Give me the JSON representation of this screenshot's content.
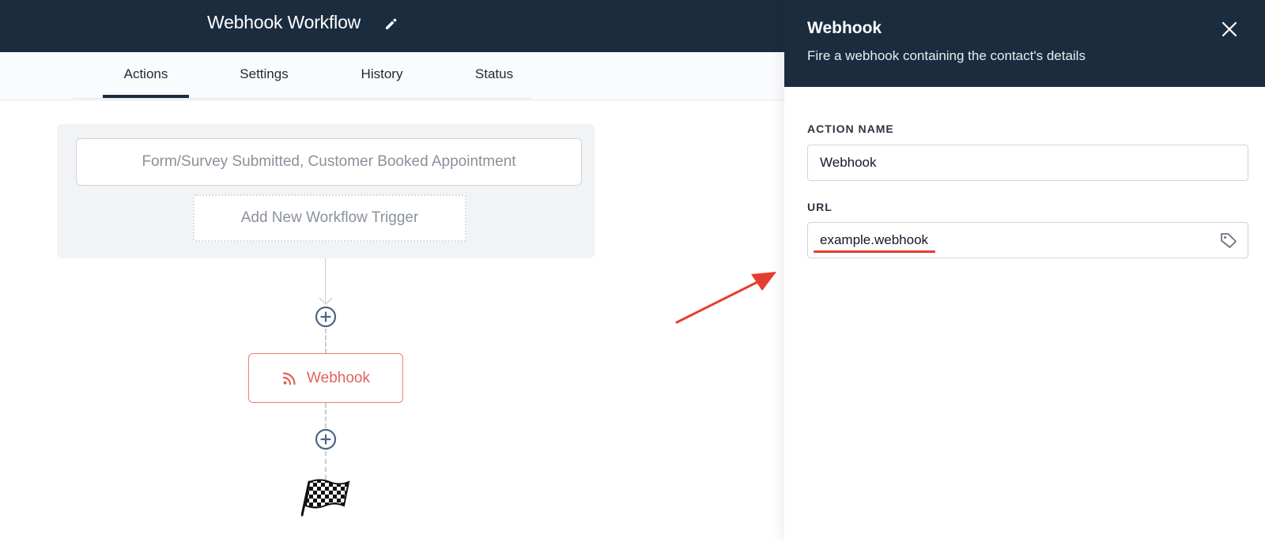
{
  "header": {
    "workflow_title": "Webhook Workflow",
    "edit_icon": "pencil-icon",
    "bg_color": "#1b2c3e"
  },
  "tabs": [
    {
      "label": "Actions",
      "active": true
    },
    {
      "label": "Settings",
      "active": false
    },
    {
      "label": "History",
      "active": false
    },
    {
      "label": "Status",
      "active": false
    }
  ],
  "triggers": {
    "trigger_label": "Form/Survey Submitted, Customer Booked Appointment",
    "add_trigger_label": "Add New Workflow Trigger"
  },
  "flow": {
    "add_action_icon": "plus-circle-icon",
    "action_node": {
      "label": "Webhook",
      "icon": "rss-icon",
      "color": "#e5605a"
    },
    "end_icon": "checkered-flag-icon"
  },
  "drawer": {
    "title": "Webhook",
    "subtitle": "Fire a webhook containing the contact's details",
    "close_icon": "close-icon",
    "action_name_label": "ACTION NAME",
    "action_name_value": "Webhook",
    "url_label": "URL",
    "url_value": "example.webhook",
    "url_tag_icon": "tag-icon"
  },
  "annotation": {
    "arrow_color": "#e53d2f",
    "underline_color": "#e53d2f"
  }
}
